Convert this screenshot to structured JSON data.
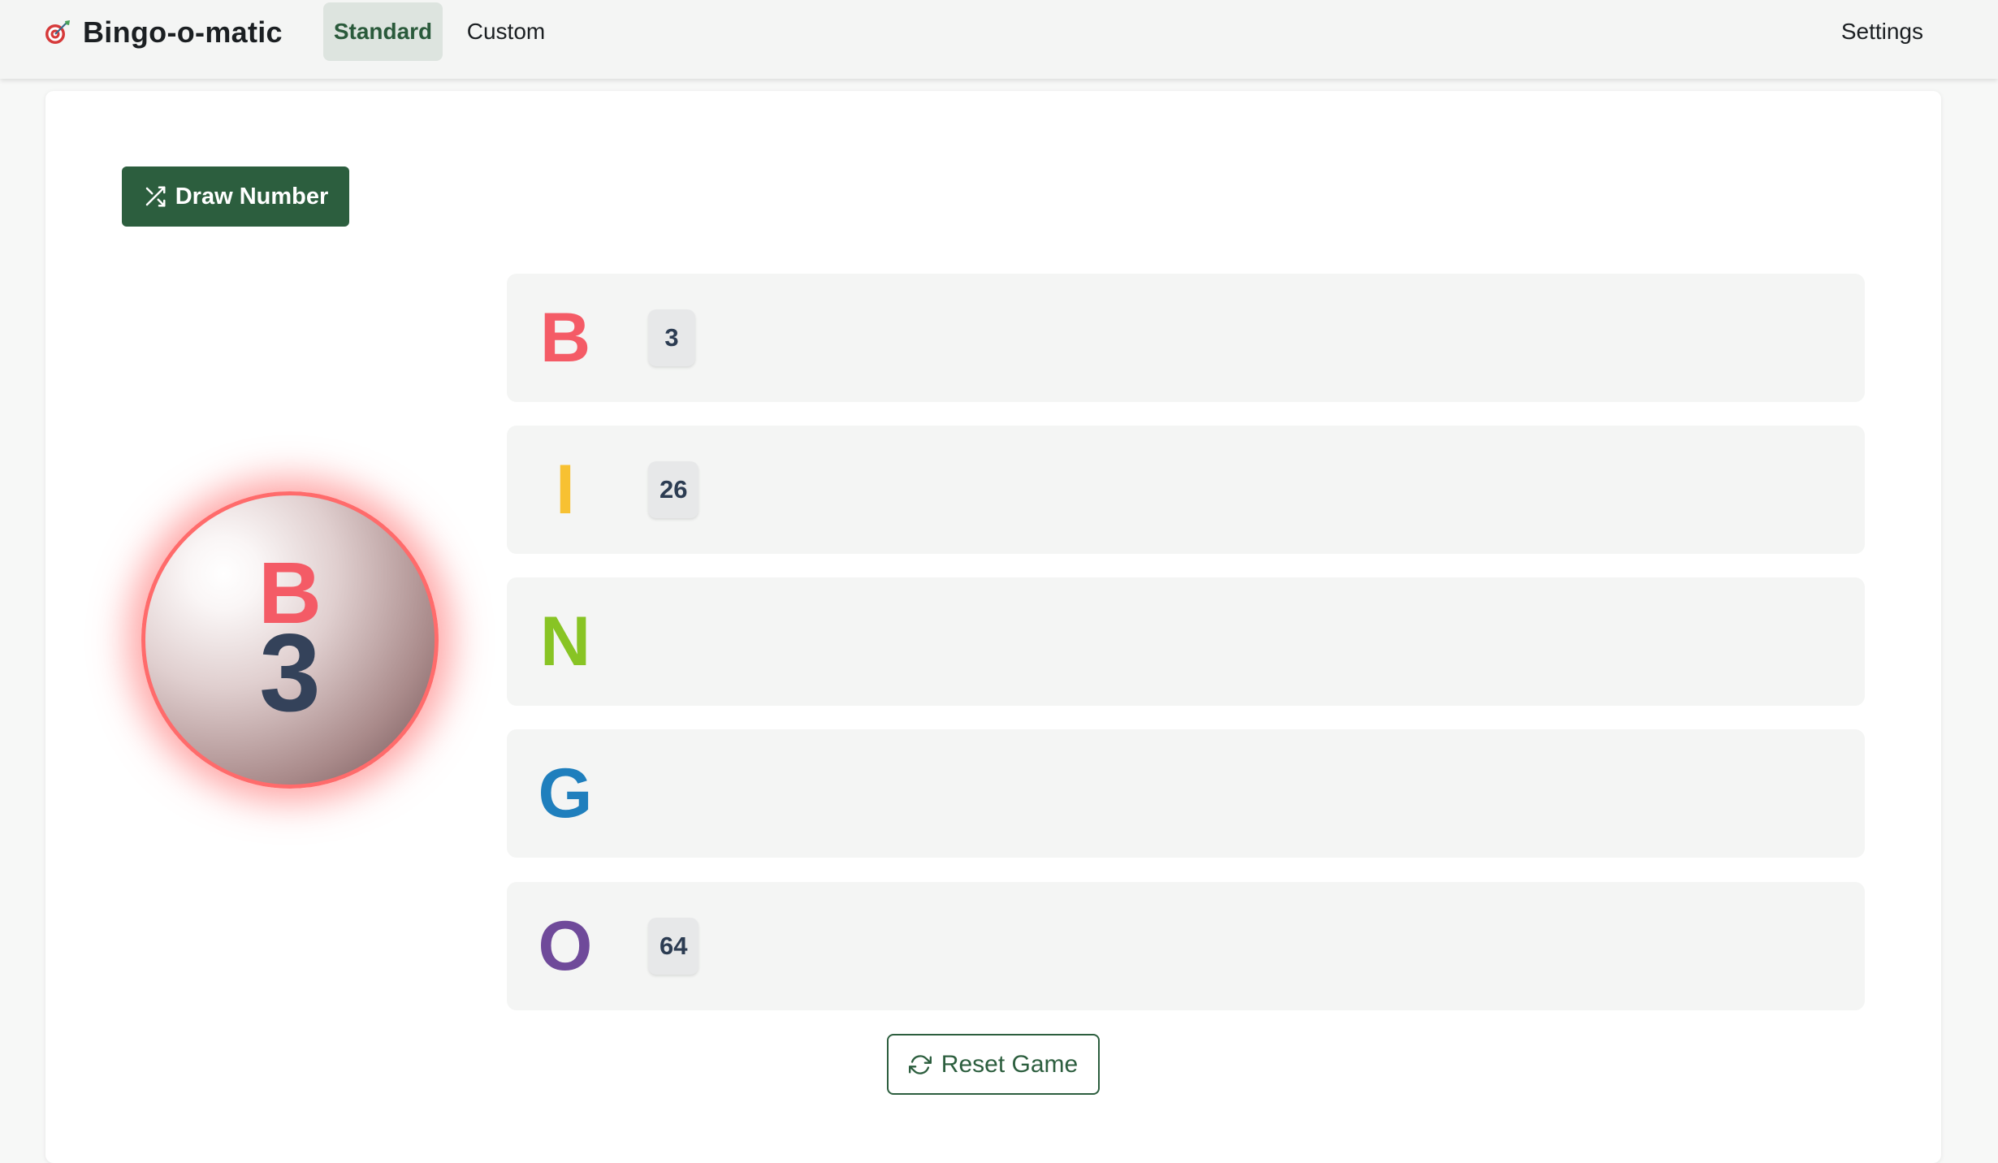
{
  "app": {
    "brand_icon": "dart-target-icon",
    "name": "Bingo-o-matic"
  },
  "nav": {
    "tabs": [
      {
        "label": "Standard",
        "active": true
      },
      {
        "label": "Custom",
        "active": false
      }
    ],
    "settings_label": "Settings"
  },
  "controls": {
    "draw_label": "Draw Number",
    "draw_icon": "shuffle-icon",
    "reset_label": "Reset Game",
    "reset_icon": "refresh-icon"
  },
  "current_ball": {
    "letter": "B",
    "number": "3"
  },
  "board": {
    "rows": [
      {
        "letter": "B",
        "color": "#f45b66",
        "called": [
          "3"
        ]
      },
      {
        "letter": "I",
        "color": "#f7c132",
        "called": [
          "26"
        ]
      },
      {
        "letter": "N",
        "color": "#88c424",
        "called": []
      },
      {
        "letter": "G",
        "color": "#1f7fbd",
        "called": []
      },
      {
        "letter": "O",
        "color": "#6f4a9a",
        "called": [
          "64"
        ]
      }
    ]
  },
  "colors": {
    "primary": "#2c5e3e",
    "ball_glow": "#ff6b6b",
    "number_text": "#2c3c52"
  }
}
